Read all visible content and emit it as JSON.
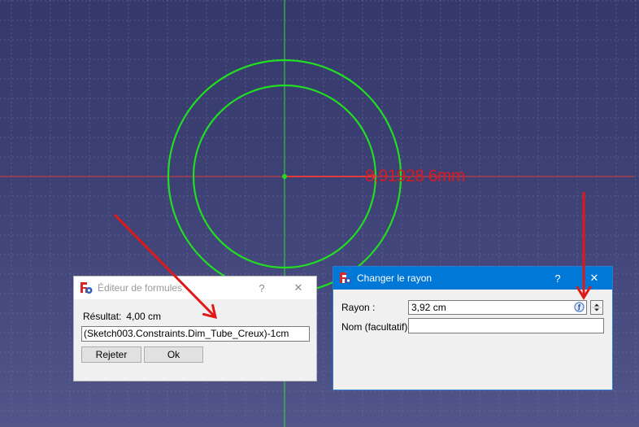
{
  "viewport": {
    "dimension_text": "8,91928 6mm",
    "colors": {
      "grid": "#6a6e99",
      "x_axis": "#e23a3a",
      "y_axis": "#33dd33",
      "sketch": "#22dd22",
      "arrows": "#e01818"
    }
  },
  "formula_editor": {
    "title": "Éditeur de formules",
    "help_glyph": "?",
    "close_glyph": "✕",
    "result_label": "Résultat:",
    "result_value": "4,00 cm",
    "expression": "(Sketch003.Constraints.Dim_Tube_Creux)-1cm",
    "reject_label": "Rejeter",
    "ok_label": "Ok",
    "icon": "freecad-icon"
  },
  "radius_dialog": {
    "title": "Changer le rayon",
    "help_glyph": "?",
    "close_glyph": "✕",
    "radius_label": "Rayon :",
    "radius_value": "3,92 cm",
    "name_label": "Nom (facultatif)",
    "name_value": "",
    "icon": "freecad-icon"
  }
}
